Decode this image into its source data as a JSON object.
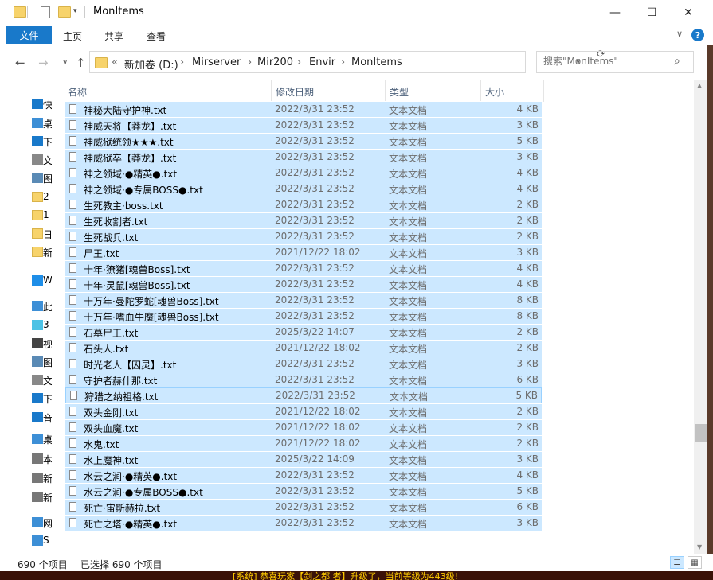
{
  "window": {
    "title": "MonItems",
    "minimize": "—",
    "maximize": "☐",
    "close": "✕"
  },
  "ribbon": {
    "file_tab": "文件",
    "tabs": [
      "主页",
      "共享",
      "查看"
    ],
    "expand": "∨",
    "help": "?"
  },
  "nav": {
    "back": "←",
    "forward": "→",
    "recent": "∨",
    "up": "↑"
  },
  "address": {
    "overflow": "«",
    "crumbs": [
      "新加卷 (D:)",
      "Mirserver",
      "Mir200",
      "Envir",
      "MonItems"
    ],
    "separator": "›",
    "dropdown": "∨",
    "refresh": "⟳"
  },
  "search": {
    "placeholder": "搜索\"MonItems\"",
    "icon": "⌕"
  },
  "navpane": {
    "items": [
      {
        "label": "快",
        "icon": "star-icon",
        "chevron": ""
      },
      {
        "label": "桌",
        "icon": "desktop-icon",
        "chevron": ""
      },
      {
        "label": "下",
        "icon": "download-icon",
        "chevron": ""
      },
      {
        "label": "文",
        "icon": "document-icon",
        "chevron": ""
      },
      {
        "label": "图",
        "icon": "pictures-icon",
        "chevron": ""
      },
      {
        "label": "2",
        "icon": "folder-icon",
        "chevron": ""
      },
      {
        "label": "1",
        "icon": "folder-icon",
        "chevron": ""
      },
      {
        "label": "日",
        "icon": "folder-icon",
        "chevron": ""
      },
      {
        "label": "新",
        "icon": "folder-icon",
        "chevron": ""
      },
      {
        "label": "W",
        "icon": "cloud-icon",
        "chevron": ""
      },
      {
        "label": "此",
        "icon": "computer-icon",
        "chevron": ""
      },
      {
        "label": "3",
        "icon": "cube-icon",
        "chevron": ""
      },
      {
        "label": "视",
        "icon": "video-icon",
        "chevron": ""
      },
      {
        "label": "图",
        "icon": "pictures-icon",
        "chevron": ""
      },
      {
        "label": "文",
        "icon": "document-icon",
        "chevron": ""
      },
      {
        "label": "下",
        "icon": "download-icon",
        "chevron": ""
      },
      {
        "label": "音",
        "icon": "music-icon",
        "chevron": ""
      },
      {
        "label": "桌",
        "icon": "desktop-icon",
        "chevron": ""
      },
      {
        "label": "本",
        "icon": "drive-icon",
        "chevron": ""
      },
      {
        "label": "新",
        "icon": "drive-icon",
        "chevron": ""
      },
      {
        "label": "新",
        "icon": "drive-icon",
        "chevron": ""
      },
      {
        "label": "网",
        "icon": "network-icon",
        "chevron": ""
      },
      {
        "label": "S",
        "icon": "computer-icon",
        "chevron": ""
      }
    ]
  },
  "columns": {
    "name": "名称",
    "date": "修改日期",
    "type": "类型",
    "size": "大小",
    "sort": "^"
  },
  "files": [
    {
      "name": "神秘大陆守护神.txt",
      "date": "2022/3/31 23:52",
      "type": "文本文档",
      "size": "4 KB"
    },
    {
      "name": "神威天将【莽龙】.txt",
      "date": "2022/3/31 23:52",
      "type": "文本文档",
      "size": "3 KB"
    },
    {
      "name": "神威狱统领★★★.txt",
      "date": "2022/3/31 23:52",
      "type": "文本文档",
      "size": "5 KB"
    },
    {
      "name": "神威狱卒【莽龙】.txt",
      "date": "2022/3/31 23:52",
      "type": "文本文档",
      "size": "3 KB"
    },
    {
      "name": "神之领域·●精英●.txt",
      "date": "2022/3/31 23:52",
      "type": "文本文档",
      "size": "4 KB"
    },
    {
      "name": "神之领域·●专属BOSS●.txt",
      "date": "2022/3/31 23:52",
      "type": "文本文档",
      "size": "4 KB"
    },
    {
      "name": "生死教主·boss.txt",
      "date": "2022/3/31 23:52",
      "type": "文本文档",
      "size": "2 KB"
    },
    {
      "name": "生死收割者.txt",
      "date": "2022/3/31 23:52",
      "type": "文本文档",
      "size": "2 KB"
    },
    {
      "name": "生死战兵.txt",
      "date": "2022/3/31 23:52",
      "type": "文本文档",
      "size": "2 KB"
    },
    {
      "name": "尸王.txt",
      "date": "2021/12/22 18:02",
      "type": "文本文档",
      "size": "3 KB"
    },
    {
      "name": "十年·獠猪[魂兽Boss].txt",
      "date": "2022/3/31 23:52",
      "type": "文本文档",
      "size": "4 KB"
    },
    {
      "name": "十年·灵鼠[魂兽Boss].txt",
      "date": "2022/3/31 23:52",
      "type": "文本文档",
      "size": "4 KB"
    },
    {
      "name": "十万年·曼陀罗蛇[魂兽Boss].txt",
      "date": "2022/3/31 23:52",
      "type": "文本文档",
      "size": "8 KB"
    },
    {
      "name": "十万年·嗜血牛魔[魂兽Boss].txt",
      "date": "2022/3/31 23:52",
      "type": "文本文档",
      "size": "8 KB"
    },
    {
      "name": "石墓尸王.txt",
      "date": "2025/3/22 14:07",
      "type": "文本文档",
      "size": "2 KB"
    },
    {
      "name": "石头人.txt",
      "date": "2021/12/22 18:02",
      "type": "文本文档",
      "size": "2 KB"
    },
    {
      "name": "时光老人【囚灵】.txt",
      "date": "2022/3/31 23:52",
      "type": "文本文档",
      "size": "3 KB"
    },
    {
      "name": "守护者赫什那.txt",
      "date": "2022/3/31 23:52",
      "type": "文本文档",
      "size": "6 KB"
    },
    {
      "name": "狩猎之纳祖格.txt",
      "date": "2022/3/31 23:52",
      "type": "文本文档",
      "size": "5 KB"
    },
    {
      "name": "双头金刚.txt",
      "date": "2021/12/22 18:02",
      "type": "文本文档",
      "size": "2 KB"
    },
    {
      "name": "双头血魔.txt",
      "date": "2021/12/22 18:02",
      "type": "文本文档",
      "size": "2 KB"
    },
    {
      "name": "水鬼.txt",
      "date": "2021/12/22 18:02",
      "type": "文本文档",
      "size": "2 KB"
    },
    {
      "name": "水上魔神.txt",
      "date": "2025/3/22 14:09",
      "type": "文本文档",
      "size": "3 KB"
    },
    {
      "name": "水云之涧·●精英●.txt",
      "date": "2022/3/31 23:52",
      "type": "文本文档",
      "size": "4 KB"
    },
    {
      "name": "水云之涧·●专属BOSS●.txt",
      "date": "2022/3/31 23:52",
      "type": "文本文档",
      "size": "5 KB"
    },
    {
      "name": "死亡·宙斯赫拉.txt",
      "date": "2022/3/31 23:52",
      "type": "文本文档",
      "size": "6 KB"
    },
    {
      "name": "死亡之塔·●精英●.txt",
      "date": "2022/3/31 23:52",
      "type": "文本文档",
      "size": "3 KB"
    }
  ],
  "focused_index": 18,
  "scrollbar": {
    "up": "▲",
    "down": "▼"
  },
  "status": {
    "count": "690 个项目",
    "selected": "已选择 690 个项目",
    "details_view": "☰",
    "tiles_view": "▦"
  },
  "bottom_strip": {
    "text": "[系统] 恭喜玩家【剑之都 者】升级了，当前等级为443级!"
  },
  "colors": {
    "accent": "#1979ca",
    "selection": "#cce8ff",
    "selection_border": "#99d1ff",
    "folder": "#f7d36b"
  }
}
